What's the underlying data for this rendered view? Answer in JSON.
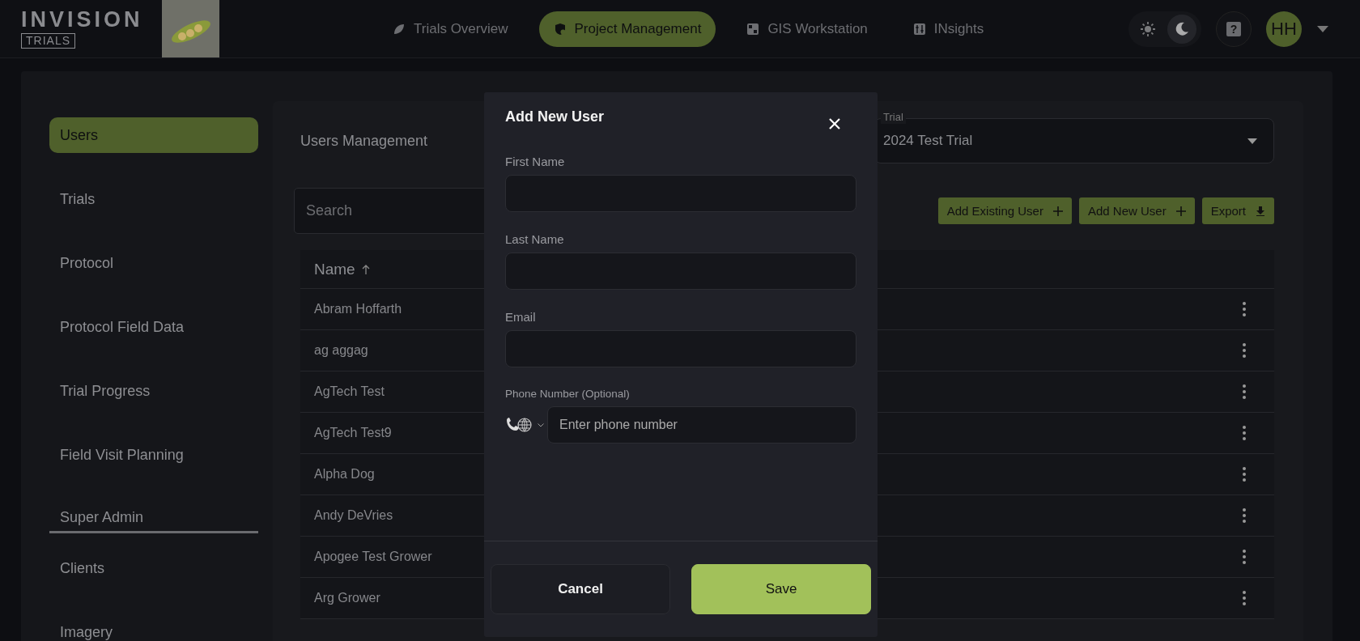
{
  "header": {
    "logo": {
      "name": "INVISION",
      "subtitle": "TRIALS"
    },
    "nav": [
      {
        "label": "Trials Overview",
        "selected": false
      },
      {
        "label": "Project Management",
        "selected": true
      },
      {
        "label": "GIS Workstation",
        "selected": false
      },
      {
        "label": "INsights",
        "selected": false
      }
    ],
    "theme": {
      "dark_mode": true
    },
    "help": {
      "label": "?"
    },
    "user": {
      "initials": "HH"
    }
  },
  "sidebar": {
    "items": [
      {
        "label": "Users",
        "selected": true
      },
      {
        "label": "Trials",
        "selected": false
      },
      {
        "label": "Protocol",
        "selected": false
      },
      {
        "label": "Protocol Field Data",
        "selected": false
      },
      {
        "label": "Trial Progress",
        "selected": false
      },
      {
        "label": "Field Visit Planning",
        "selected": false
      }
    ],
    "section_title": "Super Admin",
    "admin_items": [
      {
        "label": "Clients",
        "selected": false
      },
      {
        "label": "Imagery",
        "selected": false
      }
    ]
  },
  "users_panel": {
    "title": "Users Management",
    "search": {
      "placeholder": "Search"
    },
    "trial_select": {
      "label": "Trial",
      "value": "2024 Test Trial"
    },
    "actions": [
      {
        "label": "Add Existing User",
        "kind": "add"
      },
      {
        "label": "Add New User",
        "kind": "add"
      },
      {
        "label": "Export",
        "kind": "export"
      }
    ],
    "table": {
      "columns": [
        {
          "label": "Name",
          "sort_ascending": true
        }
      ],
      "rows": [
        {
          "name": "Abram Hoffarth"
        },
        {
          "name": "ag aggag"
        },
        {
          "name": "AgTech Test"
        },
        {
          "name": "AgTech Test9"
        },
        {
          "name": "Alpha Dog"
        },
        {
          "name": "Andy DeVries"
        },
        {
          "name": "Apogee Test Grower"
        },
        {
          "name": "Arg Grower"
        }
      ]
    }
  },
  "dialog": {
    "title": "Add New User",
    "fields": [
      {
        "label": "First Name",
        "kind": "text"
      },
      {
        "label": "Last Name",
        "kind": "text"
      },
      {
        "label": "Email",
        "kind": "text"
      },
      {
        "label": "Phone Number (Optional)",
        "kind": "phone",
        "placeholder": "Enter phone number"
      }
    ],
    "buttons": [
      {
        "label": "Cancel",
        "kind": "secondary"
      },
      {
        "label": "Save",
        "kind": "primary"
      }
    ]
  }
}
